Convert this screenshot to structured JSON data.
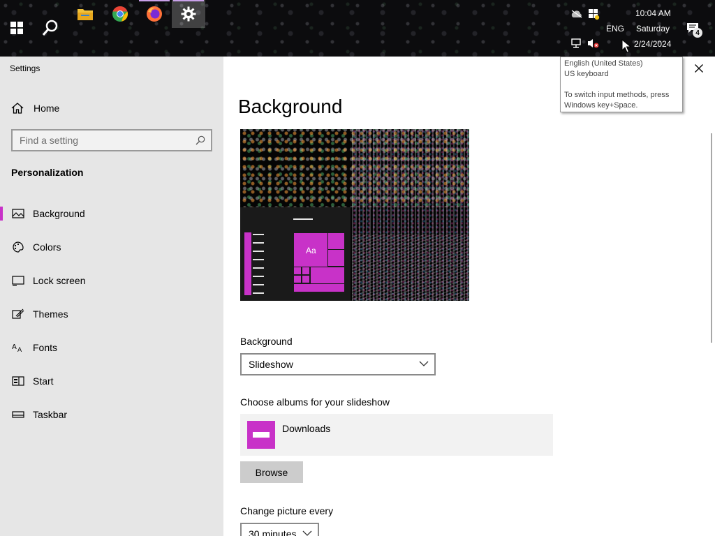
{
  "taskbar": {
    "clock": {
      "time": "10:04 AM",
      "day": "Saturday",
      "date": "2/24/2024"
    },
    "language": "ENG",
    "notification_count": "4",
    "apps": [
      "file-explorer-icon",
      "chrome-icon",
      "firefox-icon",
      "settings-icon"
    ]
  },
  "tooltip": {
    "line1": "English (United States)",
    "line2": "US keyboard",
    "line3": "To switch input methods, press",
    "line4": "Windows key+Space."
  },
  "nav": {
    "window_title": "Settings",
    "home_label": "Home",
    "search_placeholder": "Find a setting",
    "section_title": "Personalization",
    "items": [
      {
        "label": "Background",
        "icon": "picture-icon",
        "selected": true
      },
      {
        "label": "Colors",
        "icon": "palette-icon"
      },
      {
        "label": "Lock screen",
        "icon": "lock-screen-icon"
      },
      {
        "label": "Themes",
        "icon": "themes-icon"
      },
      {
        "label": "Fonts",
        "icon": "fonts-icon"
      },
      {
        "label": "Start",
        "icon": "start-icon"
      },
      {
        "label": "Taskbar",
        "icon": "taskbar-icon"
      }
    ]
  },
  "main": {
    "title": "Background",
    "preview_tile_text": "Aa",
    "background_label": "Background",
    "background_value": "Slideshow",
    "albums_label": "Choose albums for your slideshow",
    "album_name": "Downloads",
    "browse_label": "Browse",
    "change_label": "Change picture every",
    "change_value": "30 minutes"
  },
  "colors": {
    "accent": "#c832c8",
    "nav_bg": "#e6e6e6",
    "taskbar_bg": "#0c0c0e"
  }
}
